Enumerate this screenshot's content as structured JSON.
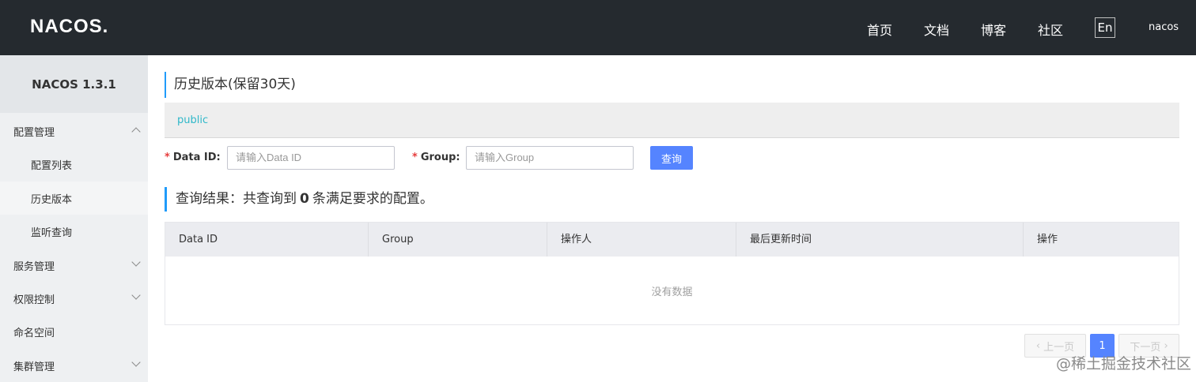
{
  "header": {
    "logo_text": "NACOS.",
    "nav": [
      "首页",
      "文档",
      "博客",
      "社区"
    ],
    "lang_button": "En",
    "user": "nacos"
  },
  "sidebar": {
    "title": "NACOS 1.3.1",
    "items": [
      {
        "label": "配置管理"
      },
      {
        "label": "配置列表"
      },
      {
        "label": "历史版本"
      },
      {
        "label": "监听查询"
      },
      {
        "label": "服务管理"
      },
      {
        "label": "权限控制"
      },
      {
        "label": "命名空间"
      },
      {
        "label": "集群管理"
      }
    ]
  },
  "main": {
    "page_title": "历史版本(保留30天)",
    "namespace": "public",
    "form": {
      "data_id_label": "Data ID:",
      "data_id_placeholder": "请输入Data ID",
      "group_label": "Group:",
      "group_placeholder": "请输入Group",
      "query_button": "查询"
    },
    "result": {
      "prefix": "查询结果：共查询到",
      "count": "0",
      "suffix": "条满足要求的配置。"
    },
    "table": {
      "columns": [
        "Data ID",
        "Group",
        "操作人",
        "最后更新时间",
        "操作"
      ],
      "empty_text": "没有数据"
    },
    "pagination": {
      "prev": "上一页",
      "current_page": "1",
      "next": "下一页"
    }
  },
  "watermark": "@稀土掘金技术社区"
}
